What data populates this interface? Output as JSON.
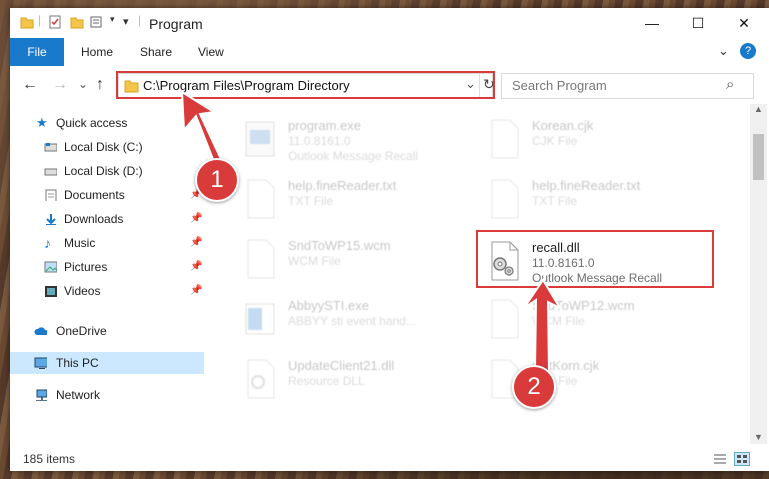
{
  "window": {
    "title": "Program",
    "controls": {
      "minimize": "—",
      "maximize": "☐",
      "close": "✕"
    }
  },
  "ribbon": {
    "tabs": [
      {
        "label": "File"
      },
      {
        "label": "Home"
      },
      {
        "label": "Share"
      },
      {
        "label": "View"
      }
    ],
    "help_glyph": "?"
  },
  "nav": {
    "back": "←",
    "forward": "→",
    "recent": "⌄",
    "up": "↑",
    "address": "C:\\Program Files\\Program Directory",
    "address_dropdown": "⌄",
    "refresh": "↻",
    "search_placeholder": "Search Program",
    "search_glyph": "⌕"
  },
  "sidebar": {
    "items": [
      {
        "label": "Quick access",
        "icon": "star-icon"
      },
      {
        "label": "Local Disk (C:)",
        "icon": "drive-icon"
      },
      {
        "label": "Local Disk (D:)",
        "icon": "drive-icon"
      },
      {
        "label": "Documents",
        "icon": "documents-icon",
        "pinned": true
      },
      {
        "label": "Downloads",
        "icon": "download-icon",
        "pinned": true
      },
      {
        "label": "Music",
        "icon": "music-icon",
        "pinned": true
      },
      {
        "label": "Pictures",
        "icon": "pictures-icon",
        "pinned": true
      },
      {
        "label": "Videos",
        "icon": "videos-icon",
        "pinned": true
      },
      {
        "label": "OneDrive",
        "icon": "cloud-icon"
      },
      {
        "label": "This PC",
        "icon": "computer-icon",
        "selected": true
      },
      {
        "label": "Network",
        "icon": "network-icon"
      }
    ],
    "pin_glyph": "📌"
  },
  "files": [
    {
      "name": "program.exe",
      "line1": "11.0.8161.0",
      "line2": "Outlook Message Recall",
      "icon": "exe-icon"
    },
    {
      "name": "Korean.cjk",
      "line1": "CJK File",
      "line2": "",
      "icon": "file-icon"
    },
    {
      "name": "help.fineReader.txt",
      "line1": "TXT File",
      "line2": "",
      "icon": "file-icon"
    },
    {
      "name": "help.fineReader.txt",
      "line1": "TXT File",
      "line2": "",
      "icon": "file-icon"
    },
    {
      "name": "SndToWP15.wcm",
      "line1": "WCM File",
      "line2": "",
      "icon": "file-icon"
    },
    {
      "name": "recall.dll",
      "line1": "11.0.8161.0",
      "line2": "Outlook Message Recall",
      "icon": "dll-gear-icon"
    },
    {
      "name": "AbbyySTI.exe",
      "line1": "ABBYY sti event hand...",
      "line2": "",
      "icon": "exe-icon"
    },
    {
      "name": "SndToWP12.wcm",
      "line1": "WCM File",
      "line2": "",
      "icon": "file-icon"
    },
    {
      "name": "UpdateClient21.dll",
      "line1": "Resource DLL",
      "line2": "",
      "icon": "dll-gear-icon"
    },
    {
      "name": "ChtKorn.cjk",
      "line1": "CJK File",
      "line2": "",
      "icon": "file-icon"
    }
  ],
  "status": {
    "items_count": "185 items"
  },
  "callouts": {
    "one": "1",
    "two": "2"
  },
  "colors": {
    "accent": "#1979ca",
    "highlight": "#d93a3a",
    "selected": "#cce8ff"
  }
}
